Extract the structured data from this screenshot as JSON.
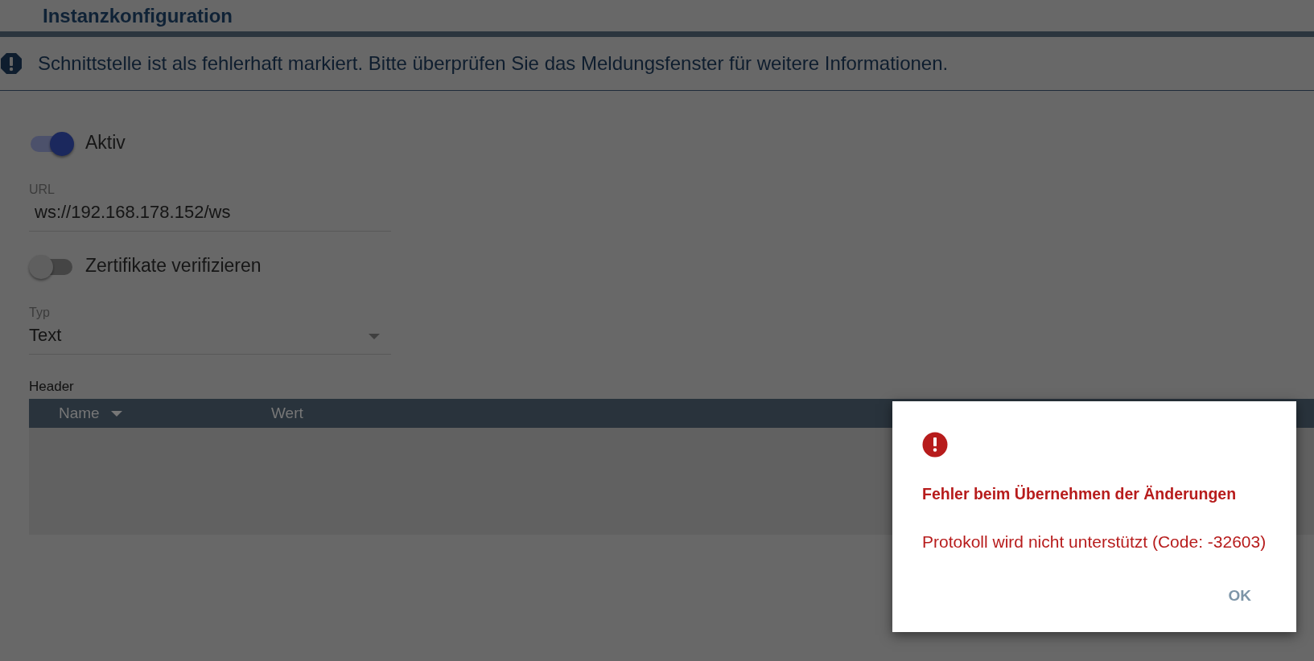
{
  "page": {
    "title": "Instanzkonfiguration"
  },
  "alert": {
    "message": "Schnittstelle ist als fehlerhaft markiert. Bitte überprüfen Sie das Meldungsfenster für weitere Informationen."
  },
  "form": [
    {
      "kind": "toggle",
      "label": "Aktiv",
      "on": true
    },
    {
      "kind": "text",
      "label": "URL",
      "value": "ws://192.168.178.152/ws"
    },
    {
      "kind": "toggle",
      "label": "Zertifikate verifizieren",
      "on": false
    },
    {
      "kind": "select",
      "label": "Typ",
      "value": "Text"
    }
  ],
  "header_table": {
    "label": "Header",
    "columns": [
      {
        "label": "Name",
        "sorted": true
      },
      {
        "label": "Wert",
        "sorted": false
      }
    ]
  },
  "dialog": {
    "title": "Fehler beim Übernehmen der Änderungen",
    "message": "Protokoll wird nicht unterstützt (Code: -32603)",
    "button": "OK"
  }
}
